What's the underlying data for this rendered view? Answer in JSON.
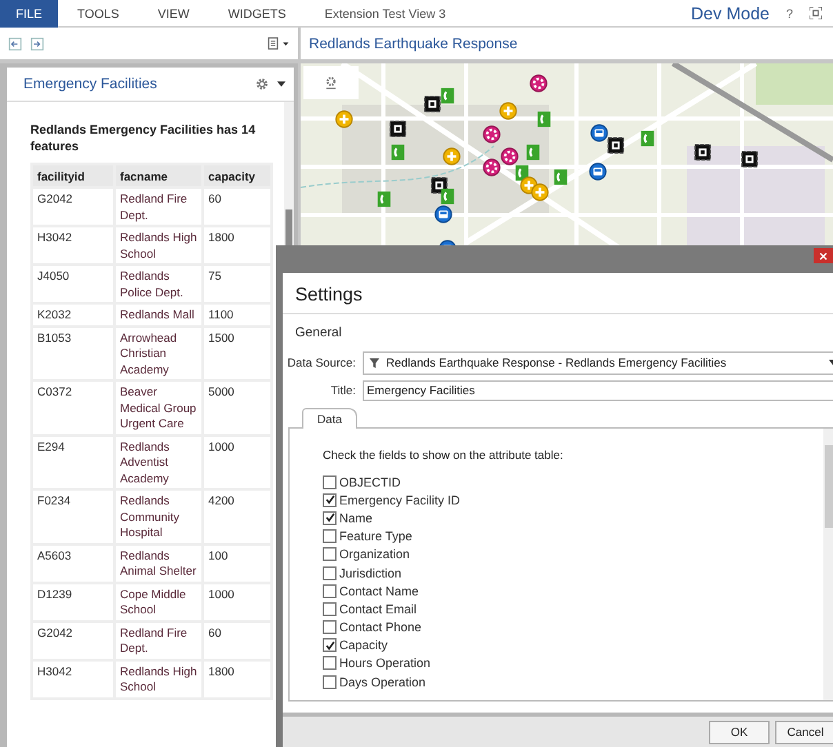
{
  "menu_bar": {
    "items": [
      {
        "label": "FILE",
        "selected": true
      },
      {
        "label": "TOOLS",
        "selected": false
      },
      {
        "label": "VIEW",
        "selected": false
      },
      {
        "label": "WIDGETS",
        "selected": false
      }
    ],
    "view_title": "Extension Test View 3",
    "mode": "Dev Mode",
    "help": "?"
  },
  "left_panel": {
    "title": "Emergency Facilities",
    "heading": "Redlands Emergency Facilities has 14 features",
    "table": {
      "columns": [
        "facilityid",
        "facname",
        "capacity"
      ],
      "rows": [
        [
          "G2042",
          "Redland Fire Dept.",
          "60"
        ],
        [
          "H3042",
          "Redlands High School",
          "1800"
        ],
        [
          "J4050",
          "Redlands Police Dept.",
          "75"
        ],
        [
          "K2032",
          "Redlands Mall",
          "1100"
        ],
        [
          "B1053",
          "Arrowhead Christian Academy",
          "1500"
        ],
        [
          "C0372",
          "Beaver Medical Group Urgent Care",
          "5000"
        ],
        [
          "E294",
          "Redlands Adventist Academy",
          "1000"
        ],
        [
          "F0234",
          "Redlands Community Hospital",
          "4200"
        ],
        [
          "A5603",
          "Redlands Animal Shelter",
          "100"
        ],
        [
          "D1239",
          "Cope Middle School",
          "1000"
        ],
        [
          "G2042",
          "Redland Fire Dept.",
          "60"
        ],
        [
          "H3042",
          "Redlands High School",
          "1800"
        ]
      ]
    }
  },
  "map": {
    "title": "Redlands Earthquake Response",
    "markers": [
      {
        "kind": "plus"
      },
      {
        "kind": "square"
      },
      {
        "kind": "phone"
      },
      {
        "kind": "plus"
      },
      {
        "kind": "ring"
      },
      {
        "kind": "phone"
      },
      {
        "kind": "square"
      },
      {
        "kind": "ring"
      },
      {
        "kind": "bus"
      },
      {
        "kind": "square"
      },
      {
        "kind": "phone"
      },
      {
        "kind": "square"
      },
      {
        "kind": "square"
      },
      {
        "kind": "phone"
      },
      {
        "kind": "plus"
      },
      {
        "kind": "ring"
      },
      {
        "kind": "ring"
      },
      {
        "kind": "phone"
      },
      {
        "kind": "phone"
      },
      {
        "kind": "phone"
      },
      {
        "kind": "bus"
      },
      {
        "kind": "square"
      },
      {
        "kind": "plus"
      },
      {
        "kind": "plus"
      },
      {
        "kind": "phone"
      },
      {
        "kind": "phone"
      },
      {
        "kind": "bus"
      },
      {
        "kind": "bus"
      }
    ]
  },
  "settings_dialog": {
    "title": "Settings",
    "section": "General",
    "data_source_label": "Data Source:",
    "data_source": "Redlands Earthquake Response - Redlands Emergency Facilities",
    "title_label": "Title:",
    "title_value": "Emergency Facilities",
    "tabs": [
      {
        "label": "Data",
        "selected": true
      }
    ],
    "instruction": "Check the fields to show on the attribute table:",
    "fields": [
      {
        "label": "OBJECTID",
        "checked": false
      },
      {
        "label": "Emergency Facility ID",
        "checked": true
      },
      {
        "label": "Name",
        "checked": true
      },
      {
        "label": "Feature Type",
        "checked": false
      },
      {
        "label": "Organization",
        "checked": false
      },
      {
        "label": "Jurisdiction",
        "checked": false
      },
      {
        "label": "Contact Name",
        "checked": false
      },
      {
        "label": "Contact Email",
        "checked": false
      },
      {
        "label": "Contact Phone",
        "checked": false
      },
      {
        "label": "Capacity",
        "checked": true
      },
      {
        "label": "Hours Operation",
        "checked": false
      },
      {
        "label": "Days Operation",
        "checked": false
      }
    ],
    "buttons": [
      "OK",
      "Cancel"
    ]
  }
}
